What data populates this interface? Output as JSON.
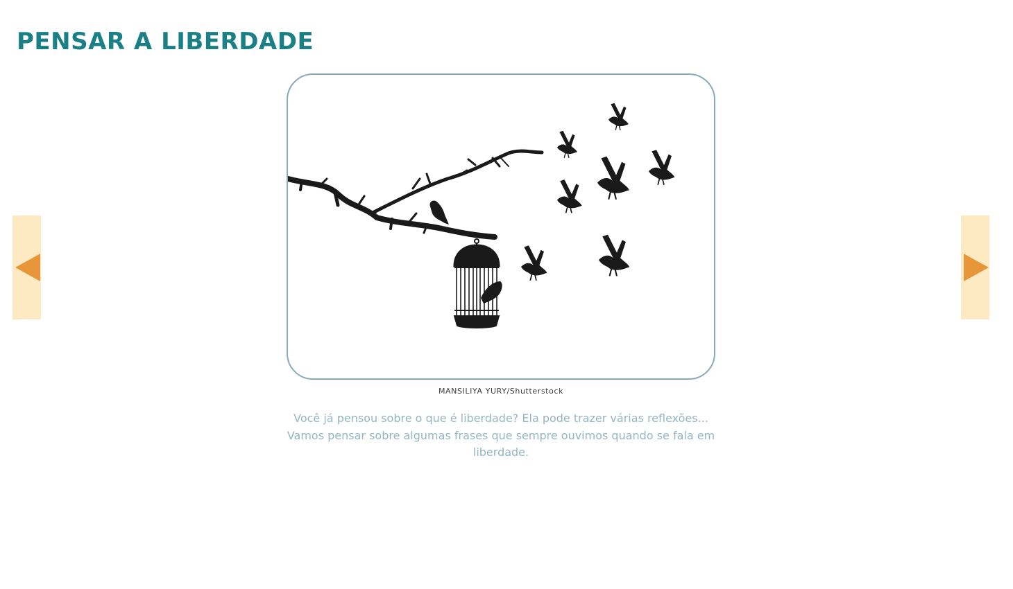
{
  "page": {
    "title": "PENSAR A LIBERDADE"
  },
  "navigation": {
    "prev_icon": "triangle-left-icon",
    "next_icon": "triangle-right-icon",
    "button_color": "#fde9c2",
    "arrow_color": "#e8963a"
  },
  "illustration": {
    "subject": "bird-cage-and-flying-birds",
    "credit": "MANSILIYA YURY/Shutterstock"
  },
  "intro": {
    "text": "Você já pensou sobre o que é liberdade? Ela pode trazer várias reflexões... Vamos pensar sobre algumas frases que sempre ouvimos quando se fala em liberdade."
  },
  "colors": {
    "title": "#1b7f86",
    "frame_border": "#89a9b8",
    "body_text": "#93b6c4",
    "silhouette": "#1a1a1a"
  }
}
